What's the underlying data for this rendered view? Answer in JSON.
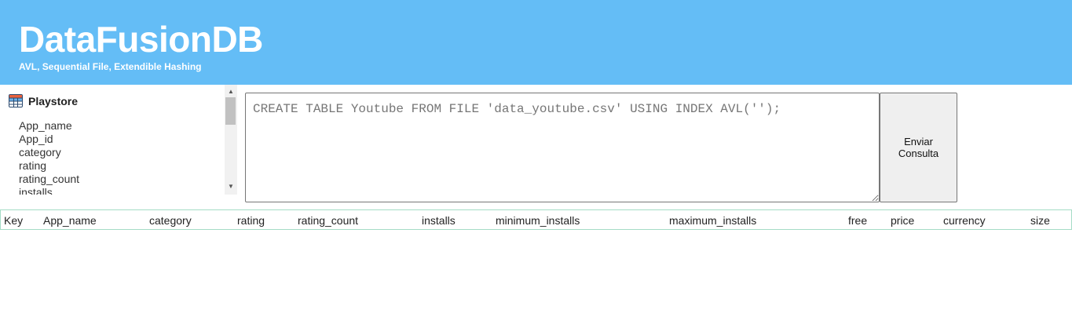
{
  "header": {
    "title": "DataFusionDB",
    "subtitle": "AVL, Sequential File, Extendible Hashing"
  },
  "sidebar": {
    "table_name": "Playstore",
    "table_icon": "table-icon",
    "columns": [
      "App_name",
      "App_id",
      "category",
      "rating",
      "rating_count",
      "installs"
    ]
  },
  "query": {
    "placeholder": "CREATE TABLE Youtube FROM FILE 'data_youtube.csv' USING INDEX AVL('');"
  },
  "send_button": {
    "label": "Enviar Consulta"
  },
  "results": {
    "headers": [
      "Key",
      "App_name",
      "category",
      "rating",
      "rating_count",
      "installs",
      "minimum_installs",
      "maximum_installs",
      "free",
      "price",
      "currency",
      "size"
    ]
  },
  "colors": {
    "header_bg": "#64bdf6",
    "table_border": "#a5dcc6"
  }
}
